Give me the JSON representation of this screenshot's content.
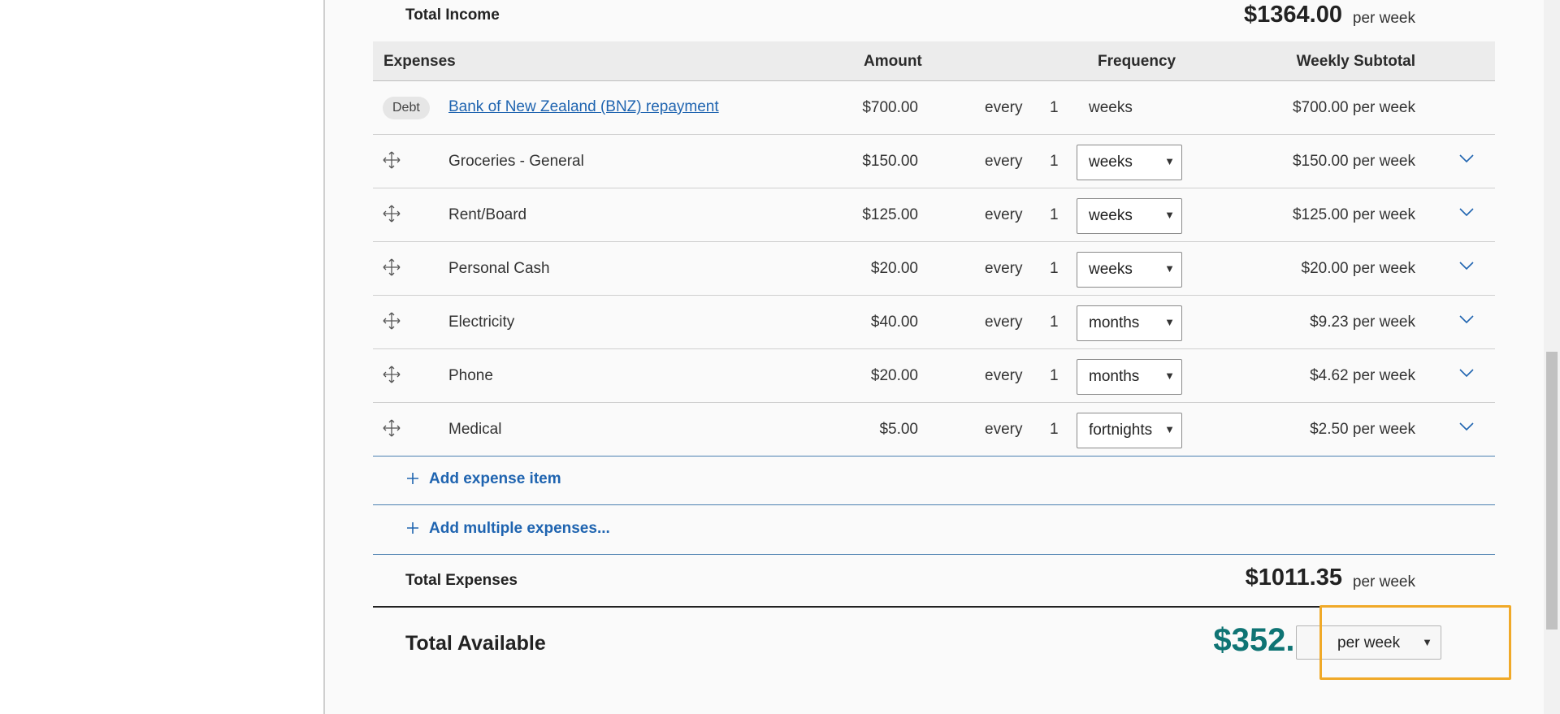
{
  "total_income": {
    "label": "Total Income",
    "amount": "$1364.00",
    "per": "per week"
  },
  "expenses_header": {
    "expenses": "Expenses",
    "amount": "Amount",
    "frequency": "Frequency",
    "subtotal": "Weekly Subtotal"
  },
  "debt_row": {
    "badge": "Debt",
    "name": "Bank of New Zealand (BNZ) repayment",
    "amount": "$700.00",
    "every": "every",
    "num": "1",
    "freq": "weeks",
    "subtotal": "$700.00 per week"
  },
  "expense_rows": [
    {
      "name": "Groceries - General",
      "amount": "$150.00",
      "every": "every",
      "num": "1",
      "freq": "weeks",
      "subtotal": "$150.00 per week"
    },
    {
      "name": "Rent/Board",
      "amount": "$125.00",
      "every": "every",
      "num": "1",
      "freq": "weeks",
      "subtotal": "$125.00 per week"
    },
    {
      "name": "Personal Cash",
      "amount": "$20.00",
      "every": "every",
      "num": "1",
      "freq": "weeks",
      "subtotal": "$20.00 per week"
    },
    {
      "name": "Electricity",
      "amount": "$40.00",
      "every": "every",
      "num": "1",
      "freq": "months",
      "subtotal": "$9.23 per week"
    },
    {
      "name": "Phone",
      "amount": "$20.00",
      "every": "every",
      "num": "1",
      "freq": "months",
      "subtotal": "$4.62 per week"
    },
    {
      "name": "Medical",
      "amount": "$5.00",
      "every": "every",
      "num": "1",
      "freq": "fortnights",
      "subtotal": "$2.50 per week"
    }
  ],
  "actions": {
    "add_expense": "Add expense item",
    "add_multiple": "Add multiple expenses..."
  },
  "total_expenses": {
    "label": "Total Expenses",
    "amount": "$1011.35",
    "per": "per week"
  },
  "total_available": {
    "label": "Total Available",
    "amount": "$352.65",
    "period": "per week"
  },
  "colors": {
    "link": "#1f64b0",
    "available": "#0f7474",
    "focus": "#f0a928"
  },
  "icons": {
    "move": "move-arrows-icon",
    "chevron": "chevron-down-icon",
    "plus": "plus-icon",
    "select_arrow": "caret-down-icon"
  }
}
